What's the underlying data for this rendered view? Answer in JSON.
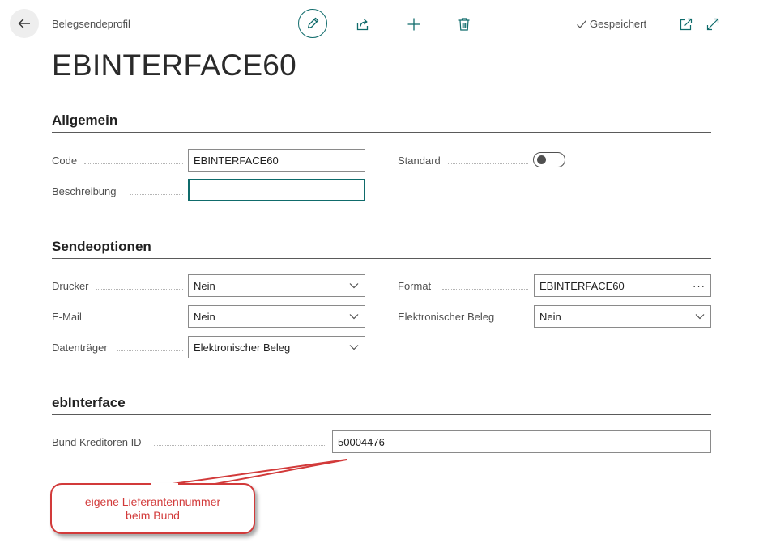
{
  "header": {
    "breadcrumb": "Belegsendeprofil",
    "saved_status": "Gespeichert"
  },
  "toolbar": {
    "icons": [
      "back-arrow-icon",
      "pencil-icon",
      "share-icon",
      "plus-icon",
      "trash-icon",
      "checkmark-icon",
      "popout-icon",
      "expand-icon"
    ]
  },
  "page": {
    "title": "EBINTERFACE60"
  },
  "sections": {
    "allgemein": {
      "title": "Allgemein",
      "code_label": "Code",
      "code_value": "EBINTERFACE60",
      "beschreibung_label": "Beschreibung",
      "beschreibung_value": "",
      "standard_label": "Standard",
      "standard_on": false
    },
    "sendeoptionen": {
      "title": "Sendeoptionen",
      "drucker_label": "Drucker",
      "drucker_value": "Nein",
      "email_label": "E-Mail",
      "email_value": "Nein",
      "datentraeger_label": "Datenträger",
      "datentraeger_value": "Elektronischer Beleg",
      "format_label": "Format",
      "format_value": "EBINTERFACE60",
      "format_lookup": "···",
      "elektronischer_beleg_label": "Elektronischer Beleg",
      "elektronischer_beleg_value": "Nein"
    },
    "ebinterface": {
      "title": "ebInterface",
      "bund_kreditoren_id_label": "Bund Kreditoren ID",
      "bund_kreditoren_id_value": "50004476"
    }
  },
  "annotation": {
    "line1": "eigene Lieferantennummer",
    "line2": "beim Bund"
  },
  "colors": {
    "accent": "#0f6b6b",
    "annotation": "#d23a3a",
    "text": "#212121",
    "label": "#505050"
  }
}
